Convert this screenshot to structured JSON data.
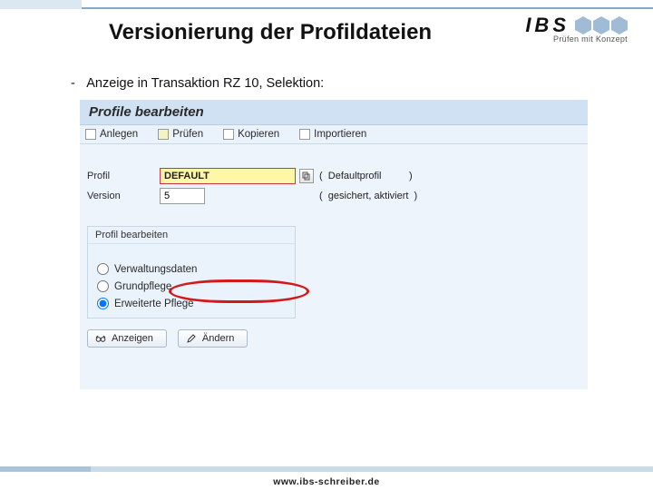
{
  "brand": {
    "name": "IBS",
    "tagline": "Prüfen mit Konzept"
  },
  "title": "Versionierung der Profildateien",
  "bullet": "Anzeige in Transaktion RZ 10, Selektion:",
  "sap": {
    "window_title": "Profile bearbeiten",
    "toolbar": {
      "anlegen": "Anlegen",
      "pruefen": "Prüfen",
      "kopieren": "Kopieren",
      "importieren": "Importieren"
    },
    "fields": {
      "profil_label": "Profil",
      "profil_value": "DEFAULT",
      "profil_desc": "Defaultprofil",
      "version_label": "Version",
      "version_value": "5",
      "version_desc": "gesichert, aktiviert"
    },
    "group": {
      "title": "Profil bearbeiten",
      "options": {
        "verwaltungsdaten": "Verwaltungsdaten",
        "grundpflege": "Grundpflege",
        "erweitert": "Erweiterte Pflege"
      }
    },
    "buttons": {
      "anzeigen": "Anzeigen",
      "aendern": "Ändern"
    }
  },
  "footer_url": "www.ibs-schreiber.de"
}
